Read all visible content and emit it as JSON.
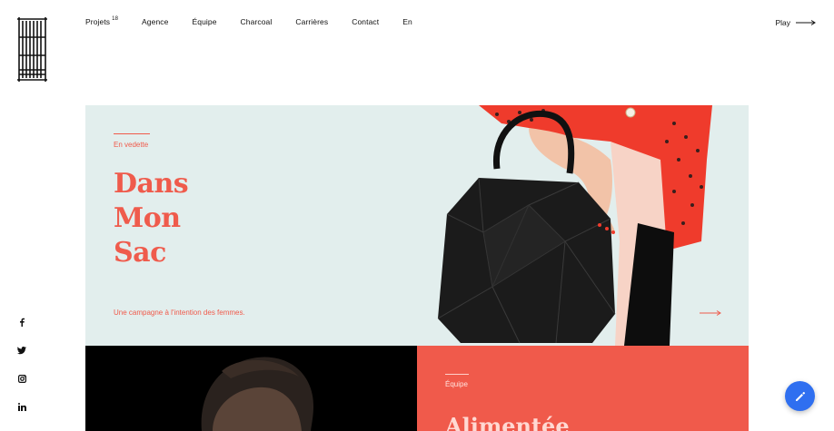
{
  "brand": {
    "logo_icon": "ladder-logo-icon"
  },
  "nav": {
    "items": [
      {
        "label": "Projets",
        "count": "18"
      },
      {
        "label": "Agence"
      },
      {
        "label": "Équipe"
      },
      {
        "label": "Charcoal"
      },
      {
        "label": "Carrières"
      },
      {
        "label": "Contact"
      },
      {
        "label": "En"
      }
    ]
  },
  "play": {
    "label": "Play",
    "icon": "arrow-right-icon"
  },
  "social": {
    "items": [
      {
        "label": "f",
        "icon": "facebook-icon"
      },
      {
        "icon": "twitter-icon"
      },
      {
        "icon": "instagram-icon"
      },
      {
        "label": "in",
        "icon": "linkedin-icon"
      }
    ]
  },
  "feature": {
    "eyebrow": "En vedette",
    "title_lines": [
      "Dans",
      "Mon",
      "Sac"
    ],
    "description": "Une campagne à l'intention des femmes.",
    "arrow_icon": "arrow-right-icon",
    "colors": {
      "background": "#e2eeed",
      "accent": "#ef5b4c"
    }
  },
  "team_card": {
    "eyebrow": "Équipe",
    "title": "Alimentée",
    "colors": {
      "background": "#f05a4b",
      "text": "#ffd9d3"
    }
  },
  "fab": {
    "icon": "pencil-icon",
    "color": "#2f6ff0"
  }
}
